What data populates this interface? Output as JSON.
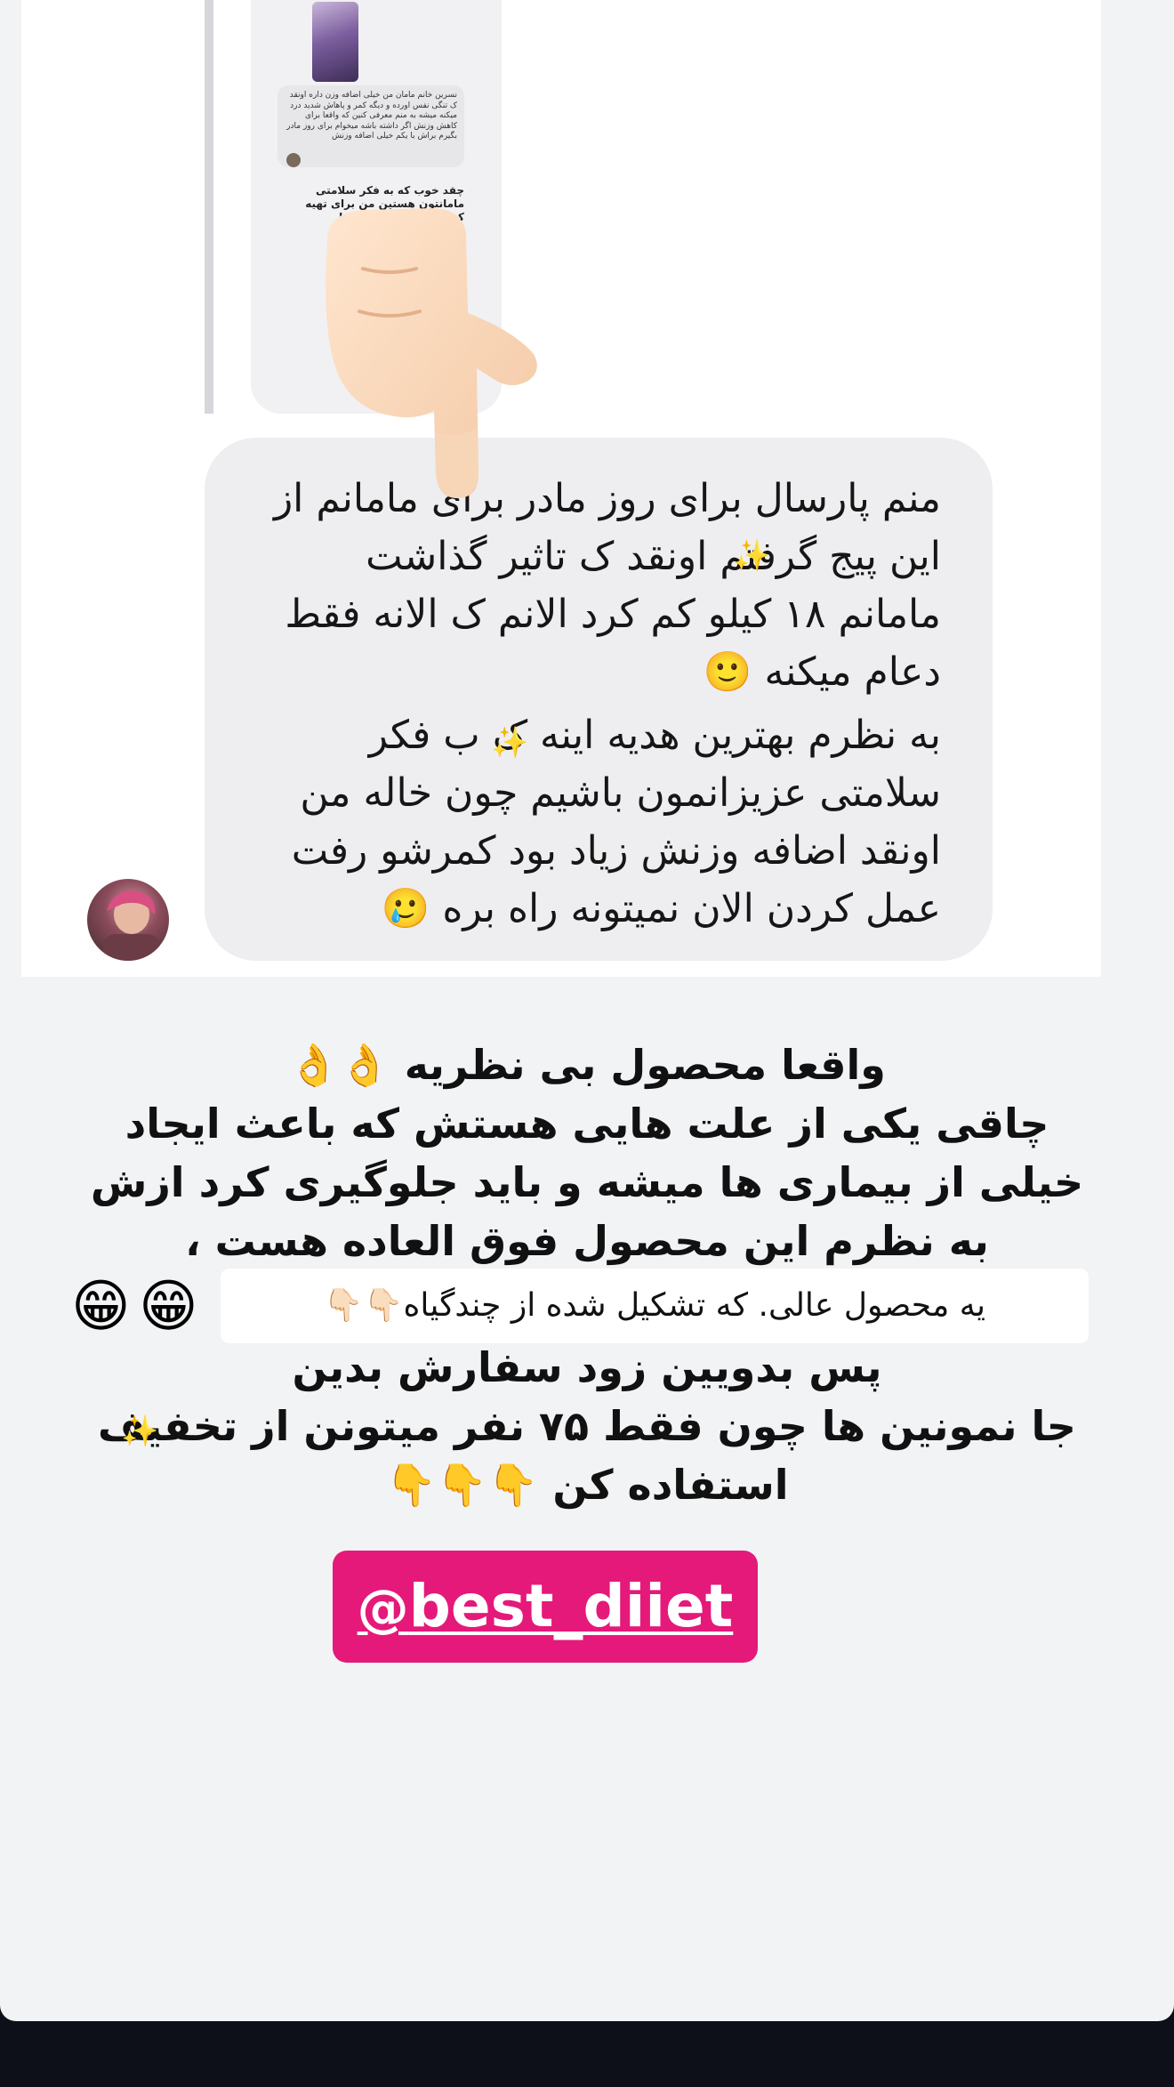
{
  "comment_screenshot": {
    "nested_reply_small_text": "نسرین خانم مامان من خیلی اضافه وزن داره اونقد ک تنگی نفس اورده و دیگه کمر و پاهاش شدید درد میکنه میشه به منم معرفی کنین که واقعا برای کاهش وزنش اگر داشته باشه میخوام برای روز مادر بگیرم براش با یکم خیلی اضافه وزنش",
    "nested_reply_bold_text": "چقد خوب که به فکر سلامتی مامانتون هستین من برای تهیه کردید دید که کل چون ما",
    "main_comment_paragraph_1": [
      "منم پارسال برای روز مادر برای مامانم از",
      "این پیج گرفتم اونقد ک تاثیر گذاشت",
      "مامانم ۱۸ کیلو کم کرد الانم ک الانه فقط",
      "دعام میکنه 🙂"
    ],
    "main_comment_paragraph_2": [
      "به نظرم بهترین هدیه اینه ک ب فکر",
      "سلامتی عزیزانمون باشیم چون خاله من",
      "اونقد اضافه وزنش زیاد بود کمرشو رفت",
      "عمل کردن الان نمیتونه راه بره 🥲"
    ]
  },
  "caption": {
    "lines": [
      "واقعا محصول بی نظریه 👌👌",
      "چاقی یکی از علت هایی هستش که باعث ایجاد",
      "خیلی از بیماری ها میشه و باید جلوگیری کرد ازش",
      "به نظرم این محصول فوق العاده هست ،"
    ],
    "highlight_strip": "یه محصول  عالی. که تشکیل شده از چندگیاه👇🏻👇🏻",
    "grin_emoji": "😁",
    "lines_after": [
      "پس بدویین زود سفارش بدین",
      "جا نمونین ها چون فقط ۷۵ نفر میتونن از تخفیف",
      "استفاده کن 👇👇👇"
    ]
  },
  "mention_sticker": {
    "at_symbol": "@",
    "handle": "best_diiet"
  },
  "colors": {
    "sticker_bg": "#e5197a",
    "story_bg": "#f2f3f5",
    "bubble_bg": "#eeeef0",
    "bottom_bar": "#0d1018"
  },
  "icons": [
    "pointing-hand-sticker",
    "sparkle-icon",
    "user-avatar"
  ]
}
